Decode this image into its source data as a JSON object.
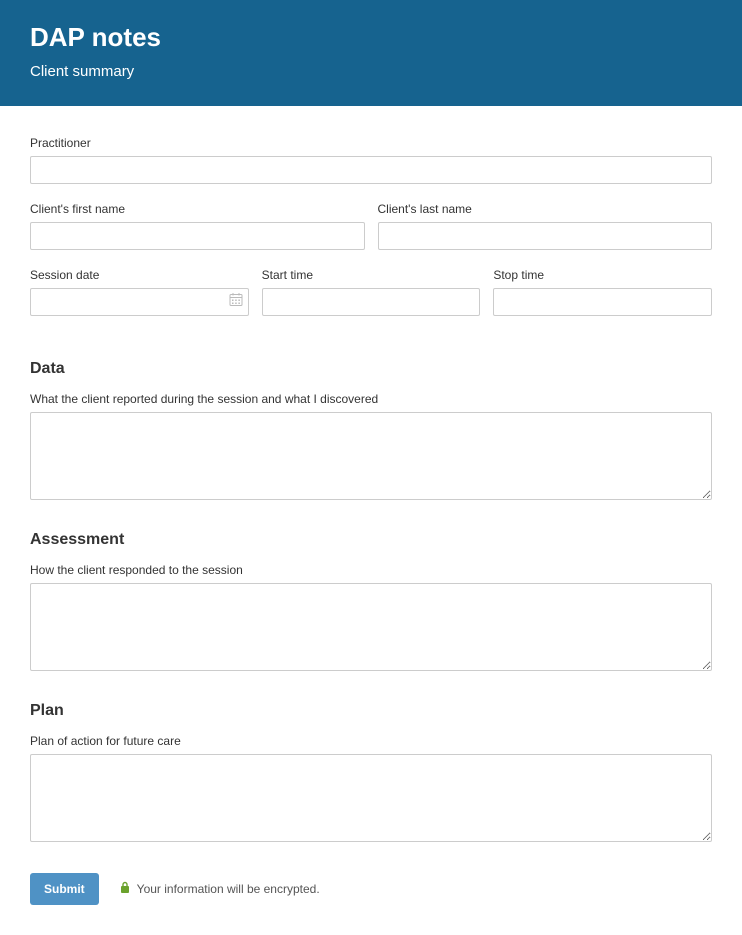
{
  "header": {
    "title": "DAP notes",
    "subtitle": "Client summary"
  },
  "fields": {
    "practitioner_label": "Practitioner",
    "first_name_label": "Client's first name",
    "last_name_label": "Client's last name",
    "session_date_label": "Session date",
    "start_time_label": "Start time",
    "stop_time_label": "Stop time"
  },
  "sections": {
    "data": {
      "heading": "Data",
      "label": "What the client reported during the session and what I discovered"
    },
    "assessment": {
      "heading": "Assessment",
      "label": "How the client responded to the session"
    },
    "plan": {
      "heading": "Plan",
      "label": "Plan of action for future care"
    }
  },
  "footer": {
    "submit_label": "Submit",
    "encrypt_text": "Your information will be encrypted."
  }
}
